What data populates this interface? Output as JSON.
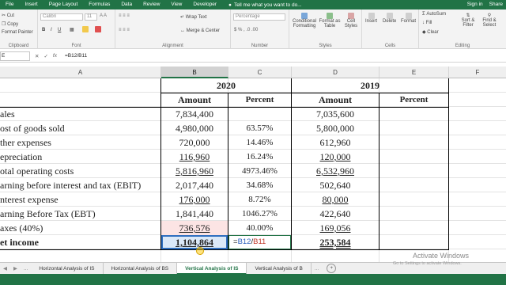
{
  "menu": {
    "tabs": [
      "File",
      "Insert",
      "Page Layout",
      "Formulas",
      "Data",
      "Review",
      "View",
      "Developer"
    ],
    "tell_me": "Tell me what you want to do...",
    "sign_in": "Sign in",
    "share": "Share"
  },
  "ribbon": {
    "clipboard": {
      "cut": "Cut",
      "copy": "Copy",
      "format_painter": "Format Painter",
      "label": "Clipboard"
    },
    "font": {
      "name": "Calibri",
      "size": "11",
      "label": "Font"
    },
    "alignment": {
      "wrap": "Wrap Text",
      "merge": "Merge & Center",
      "label": "Alignment"
    },
    "number": {
      "format": "Percentage",
      "label": "Number"
    },
    "styles": {
      "conditional": "Conditional Formatting",
      "format_table": "Format as Table",
      "cell_styles": "Cell Styles",
      "label": "Styles"
    },
    "cells": {
      "insert": "Insert",
      "delete": "Delete",
      "format": "Format",
      "label": "Cells"
    },
    "editing": {
      "autosum": "AutoSum",
      "fill": "Fill",
      "clear": "Clear",
      "sort": "Sort & Filter",
      "find": "Find & Select",
      "label": "Editing"
    }
  },
  "formula_bar": {
    "name_box": "E",
    "formula": "=B12/B11"
  },
  "columns": [
    "A",
    "B",
    "C",
    "D",
    "E",
    "F"
  ],
  "sheet": {
    "year_2020": "2020",
    "year_2019": "2019",
    "headers": {
      "b": "Amount",
      "c": "Percent",
      "d": "Amount",
      "e": "Percent"
    },
    "rows": [
      {
        "a": "ales",
        "b": "7,834,400",
        "c": "",
        "d": "7,035,600"
      },
      {
        "a": "ost of goods sold",
        "b": "4,980,000",
        "c": "63.57%",
        "d": "5,800,000"
      },
      {
        "a": "ther expenses",
        "b": "720,000",
        "c": "14.46%",
        "d": "612,960"
      },
      {
        "a": "epreciation",
        "b": "116,960",
        "c": "16.24%",
        "d": "120,000"
      },
      {
        "a": "otal operating costs",
        "b": "5,816,960",
        "c": "4973.46%",
        "d": "6,532,960"
      },
      {
        "a": "arning before interest and tax (EBIT)",
        "b": "2,017,440",
        "c": "34.68%",
        "d": "502,640"
      },
      {
        "a": "nterest expense",
        "b": "176,000",
        "c": "8.72%",
        "d": "80,000"
      },
      {
        "a": "arning Before Tax (EBT)",
        "b": "1,841,440",
        "c": "1046.27%",
        "d": "422,640"
      },
      {
        "a": "axes (40%)",
        "b": "736,576",
        "c": "40.00%",
        "d": "169,056"
      },
      {
        "a": "et income",
        "b": "1,104,864",
        "c_ref1": "B12",
        "c_ref2": "B11",
        "c_eq": "=",
        "c_slash": "/",
        "d": "253,584"
      }
    ]
  },
  "sheet_tabs": [
    "Horizontal Analysis of IS",
    "Horizontal Analysis of BS",
    "Vertical Analysis of IS",
    "Vertical Analysis of B"
  ],
  "watermark": {
    "title": "Activate Windows",
    "sub": "Go to Settings to activate Windows."
  }
}
